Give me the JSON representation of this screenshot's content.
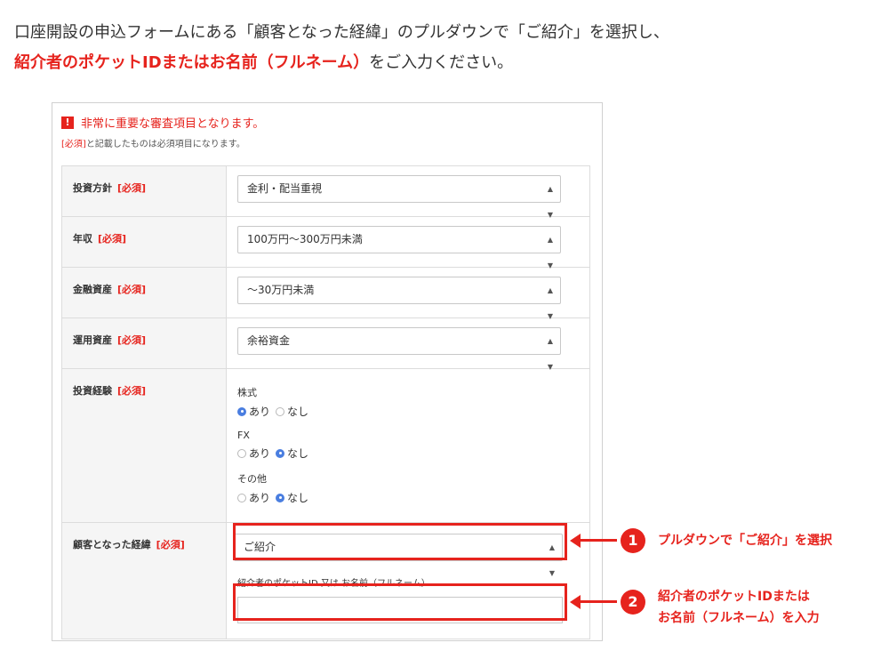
{
  "intro": {
    "line1": "口座開設の申込フォームにある「顧客となった経緯」のプルダウンで「ご紹介」を選択し、",
    "line2_highlight": "紹介者のポケットIDまたはお名前（フルネーム）",
    "line2_rest": "をご入力ください。"
  },
  "form": {
    "notice_badge": "!",
    "notice": "非常に重要な審査項目となります。",
    "required_tag": "[必須]",
    "required_rest": "と記載したものは必須項目になります。",
    "fields": [
      {
        "label": "投資方針",
        "req": "[必須]",
        "value": "金利・配当重視"
      },
      {
        "label": "年収",
        "req": "[必須]",
        "value": "100万円〜300万円未満"
      },
      {
        "label": "金融資産",
        "req": "[必須]",
        "value": "〜30万円未満"
      },
      {
        "label": "運用資産",
        "req": "[必須]",
        "value": "余裕資金"
      }
    ],
    "experience": {
      "label": "投資経験",
      "req": "[必須]",
      "groups": [
        {
          "name": "株式",
          "yes": "あり",
          "no": "なし",
          "selected": "yes"
        },
        {
          "name": "FX",
          "yes": "あり",
          "no": "なし",
          "selected": "no"
        },
        {
          "name": "その他",
          "yes": "あり",
          "no": "なし",
          "selected": "no"
        }
      ]
    },
    "reason": {
      "label": "顧客となった経緯",
      "req": "[必須]",
      "value": "ご紹介",
      "referrer_label": "紹介者のポケットID 又は お名前（フルネーム）",
      "referrer_value": ""
    }
  },
  "callouts": [
    {
      "num": "1",
      "text": "プルダウンで「ご紹介」を選択"
    },
    {
      "num": "2",
      "text_line1": "紹介者のポケットIDまたは",
      "text_line2": "お名前（フルネーム）を入力"
    }
  ],
  "colors": {
    "accent": "#e6231d",
    "radio_selected": "#4a7ee0"
  }
}
